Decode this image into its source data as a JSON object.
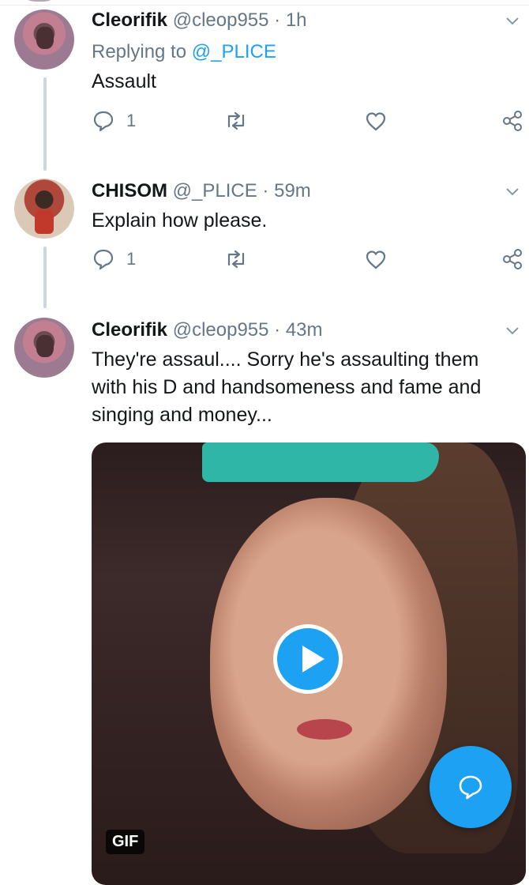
{
  "tweets": [
    {
      "name": "Cleorifik",
      "handle": "@cleop955",
      "time": "1h",
      "replying_prefix": "Replying to ",
      "replying_to": "@_PLICE",
      "text": "Assault",
      "replies": "1"
    },
    {
      "name": "CHISOM",
      "handle": "@_PLICE",
      "time": "59m",
      "text": "Explain how please.",
      "replies": "1"
    },
    {
      "name": "Cleorifik",
      "handle": "@cleop955",
      "time": "43m",
      "text": "They're assaul.... Sorry he's assaulting them with his D and handsomeness and fame and singing and money...",
      "media_badge": "GIF"
    }
  ],
  "separator": "·",
  "colors": {
    "accent": "#1da1f2",
    "muted": "#657786",
    "text": "#14171a"
  }
}
